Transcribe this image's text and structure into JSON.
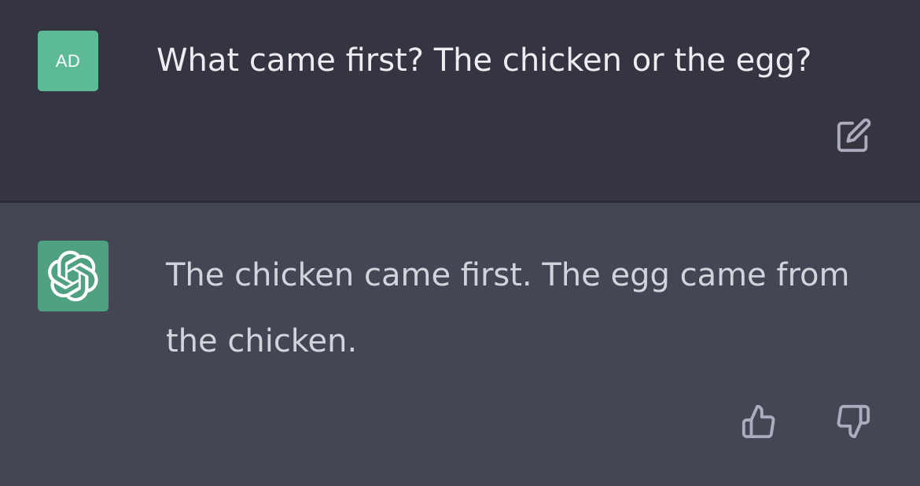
{
  "colors": {
    "user_bg": "#343541",
    "assistant_bg": "#444654",
    "user_avatar_bg": "#5cba97",
    "bot_avatar_bg": "#4fa181",
    "user_text": "#ececf1",
    "assistant_text": "#d1d5db",
    "icon": "#acacbe"
  },
  "user_message": {
    "avatar_initials": "AD",
    "text": "What came first? The chicken or the egg?",
    "edit_icon": "edit-icon"
  },
  "assistant_message": {
    "avatar_icon": "openai-logo-icon",
    "text": "The chicken came first. The egg came from the chicken.",
    "feedback": {
      "thumbs_up_icon": "thumbs-up-icon",
      "thumbs_down_icon": "thumbs-down-icon"
    }
  }
}
